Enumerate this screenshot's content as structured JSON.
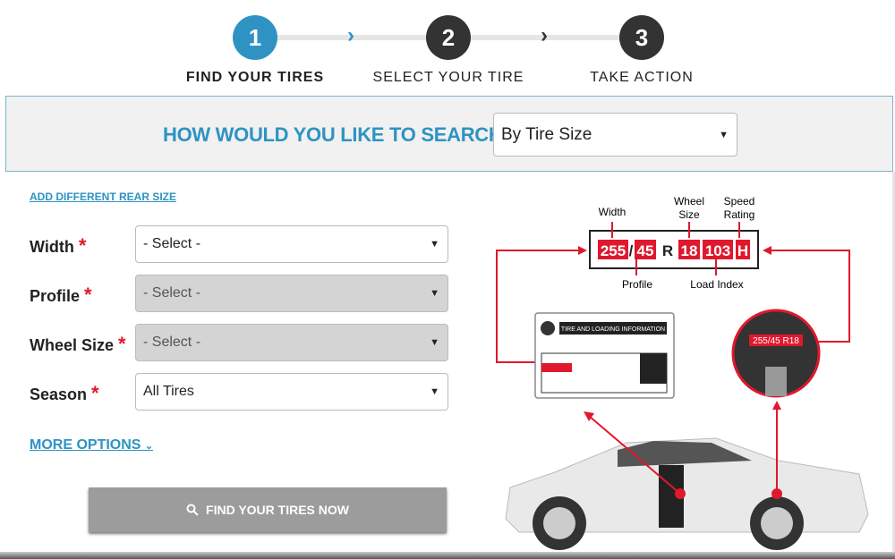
{
  "steps": [
    {
      "number": "1",
      "label": "FIND YOUR TIRES",
      "active": true
    },
    {
      "number": "2",
      "label": "SELECT YOUR TIRE",
      "active": false
    },
    {
      "number": "3",
      "label": "TAKE ACTION",
      "active": false
    }
  ],
  "search": {
    "question": "HOW WOULD YOU LIKE TO SEARCH?",
    "selected": "By Tire Size"
  },
  "form": {
    "add_rear_link": "ADD DIFFERENT REAR SIZE",
    "fields": [
      {
        "label": "Width",
        "value": "- Select -",
        "disabled": false
      },
      {
        "label": "Profile",
        "value": "- Select -",
        "disabled": true
      },
      {
        "label": "Wheel Size",
        "value": "- Select -",
        "disabled": true
      },
      {
        "label": "Season",
        "value": "All Tires",
        "disabled": false
      }
    ],
    "required_mark": "*",
    "more_options": "MORE OPTIONS",
    "submit": "FIND YOUR TIRES NOW"
  },
  "diagram": {
    "labels": {
      "width": "Width",
      "wheel": "Wheel",
      "size": "Size",
      "speed": "Speed",
      "rating": "Rating",
      "profile": "Profile",
      "load": "Load Index"
    },
    "code": {
      "width": "255",
      "sep": "/",
      "profile": "45",
      "r": "R",
      "wheel": "18",
      "load": "103",
      "speed": "H"
    },
    "placard_title": "TIRE AND LOADING INFORMATION",
    "sidewall_text": "255/45 R18"
  },
  "colors": {
    "accent": "#2e93c3",
    "red": "#e0182d",
    "dark": "#333333"
  }
}
